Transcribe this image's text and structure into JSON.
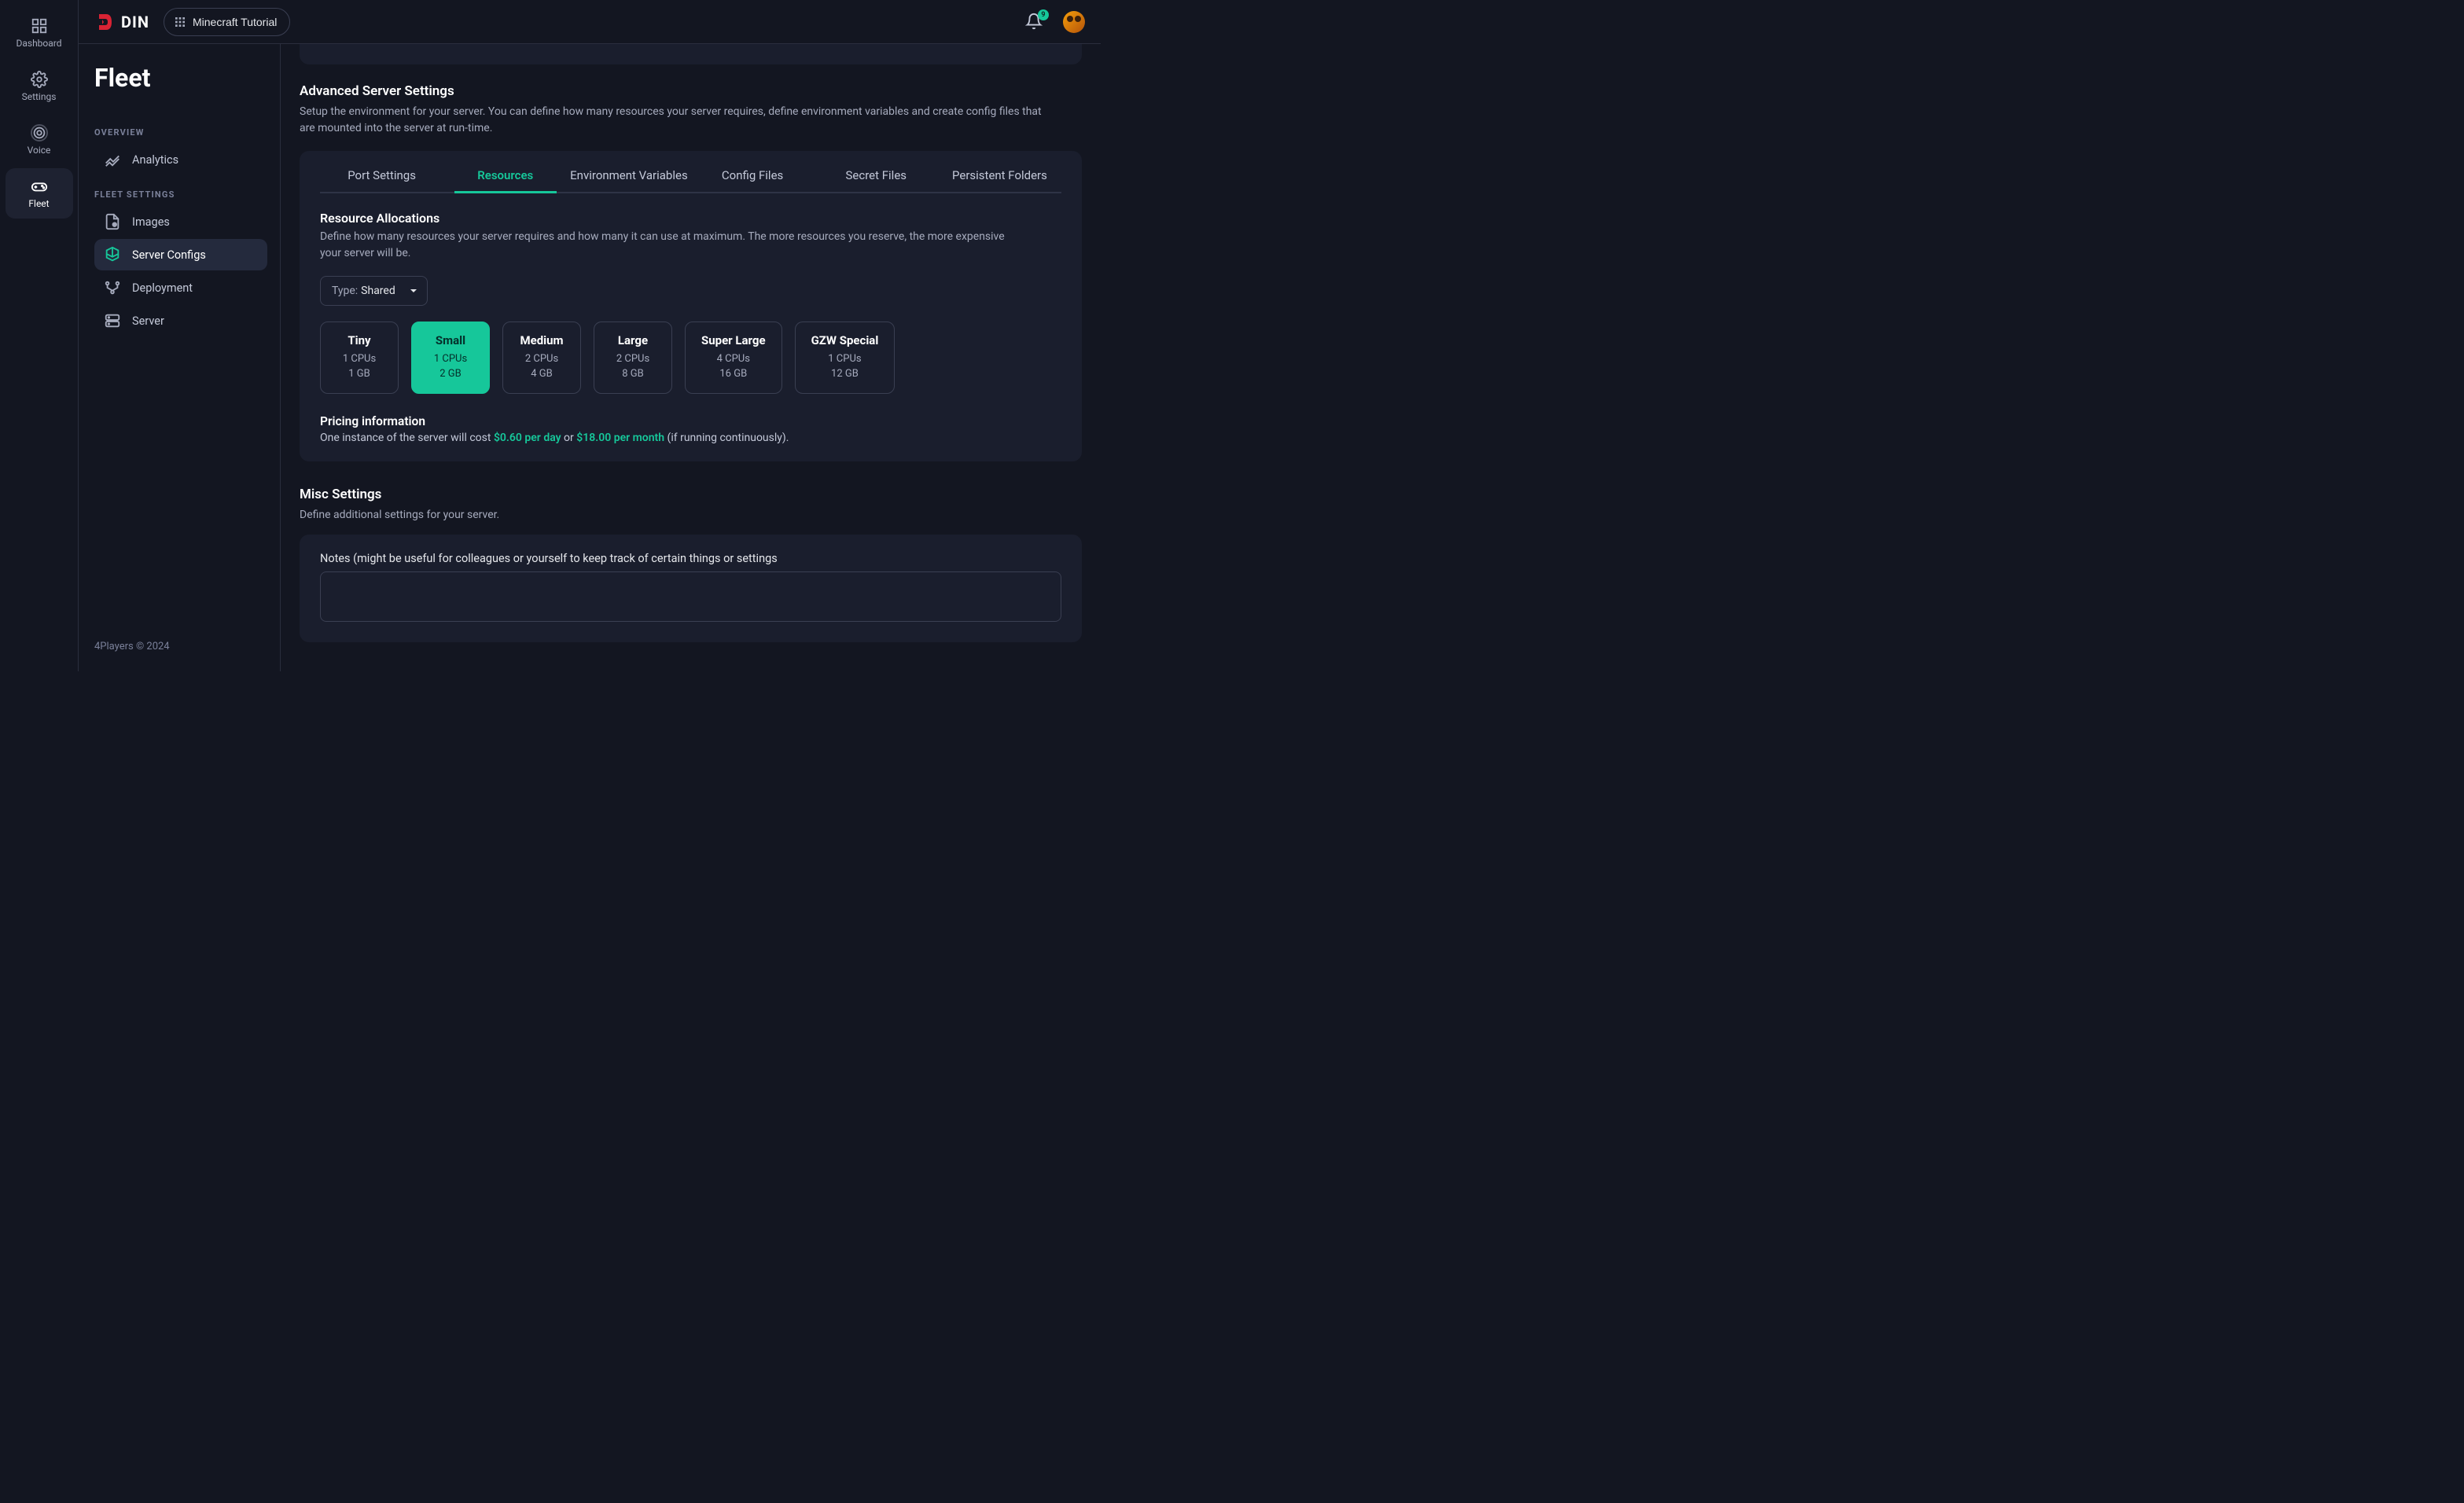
{
  "brand": "DIN",
  "topbar": {
    "breadcrumb_label": "Minecraft Tutorial",
    "notification_count": "9"
  },
  "nav_rail": {
    "dashboard": "Dashboard",
    "settings": "Settings",
    "voice": "Voice",
    "fleet": "Fleet"
  },
  "sidebar": {
    "title": "Fleet",
    "group_overview": "OVERVIEW",
    "analytics": "Analytics",
    "group_fleet_settings": "FLEET SETTINGS",
    "images": "Images",
    "server_configs": "Server Configs",
    "deployment": "Deployment",
    "server": "Server",
    "footer": "4Players © 2024"
  },
  "advanced": {
    "title": "Advanced Server Settings",
    "desc": "Setup the environment for your server. You can define how many resources your server requires, define environment variables and create config files that are mounted into the server at run-time."
  },
  "tabs": {
    "port": "Port Settings",
    "resources": "Resources",
    "env": "Environment Variables",
    "config": "Config Files",
    "secret": "Secret Files",
    "persistent": "Persistent Folders"
  },
  "resources": {
    "title": "Resource Allocations",
    "desc": "Define how many resources your server requires and how many it can use at maximum. The more resources you reserve, the more expensive your server will be.",
    "type_label": "Type:",
    "type_value": "Shared",
    "tiers": [
      {
        "name": "Tiny",
        "cpus": "1 CPUs",
        "ram": "1 GB"
      },
      {
        "name": "Small",
        "cpus": "1 CPUs",
        "ram": "2 GB"
      },
      {
        "name": "Medium",
        "cpus": "2 CPUs",
        "ram": "4 GB"
      },
      {
        "name": "Large",
        "cpus": "2 CPUs",
        "ram": "8 GB"
      },
      {
        "name": "Super Large",
        "cpus": "4 CPUs",
        "ram": "16 GB"
      },
      {
        "name": "GZW Special",
        "cpus": "1 CPUs",
        "ram": "12 GB"
      }
    ]
  },
  "pricing": {
    "title": "Pricing information",
    "prefix": "One instance of the server will cost ",
    "day": "$0.60 per day",
    "or": " or ",
    "month": "$18.00 per month",
    "suffix": " (if running continuously)."
  },
  "misc": {
    "title": "Misc Settings",
    "desc": "Define additional settings for your server.",
    "notes_label": "Notes (might be useful for colleagues or yourself to keep track of certain things or settings"
  }
}
